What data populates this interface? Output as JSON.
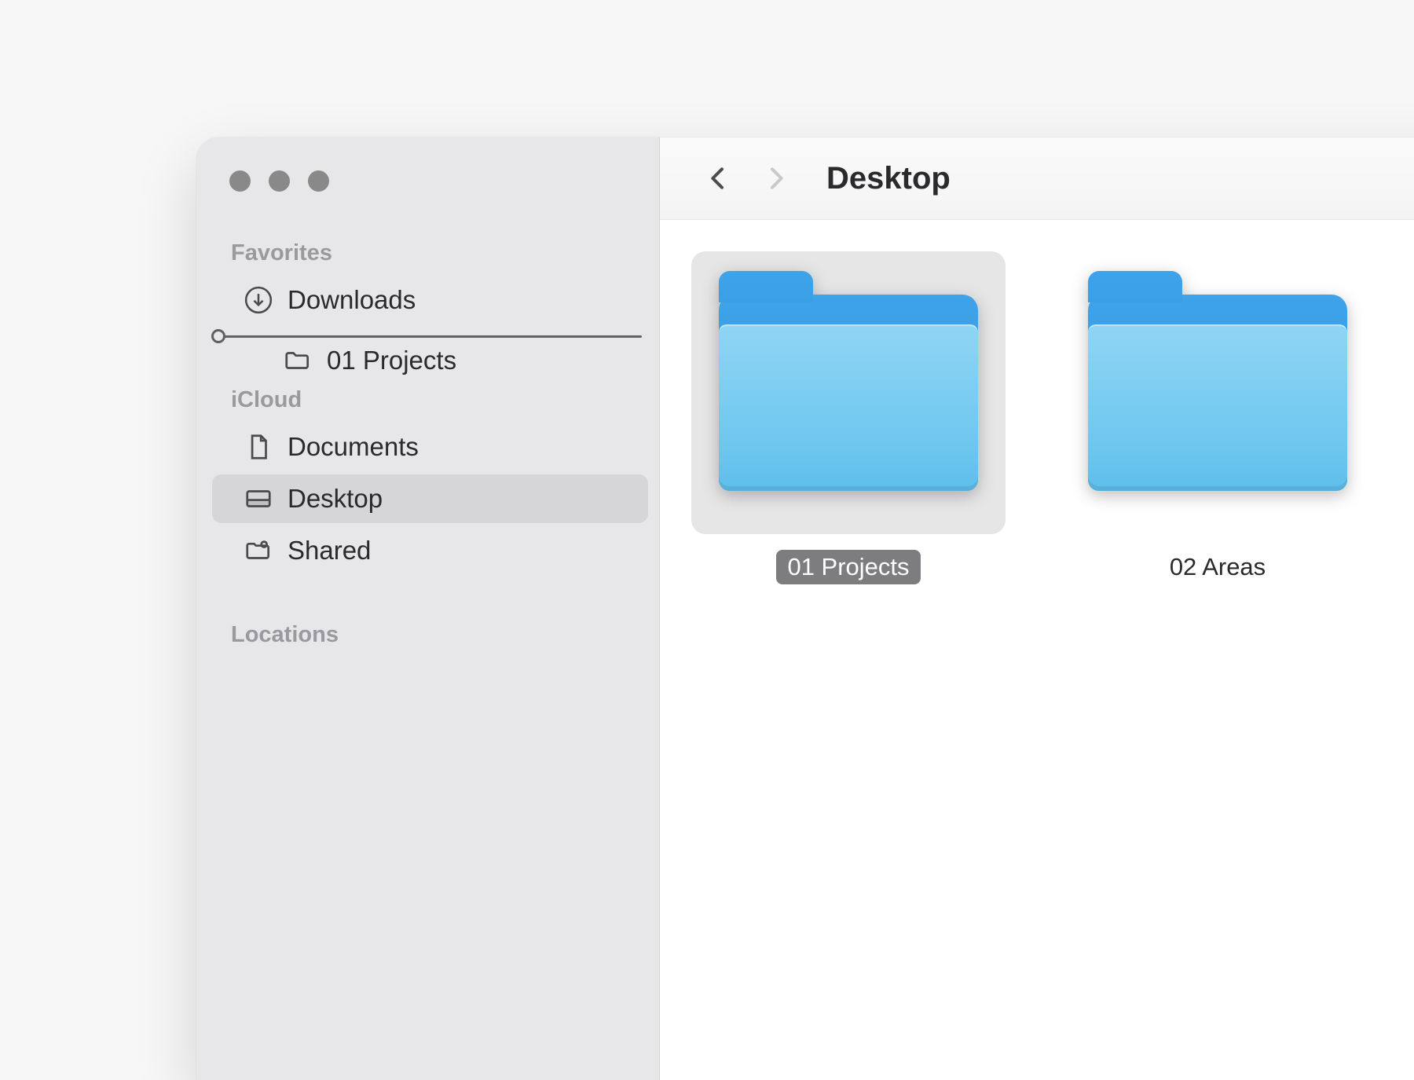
{
  "toolbar": {
    "title": "Desktop"
  },
  "sidebar": {
    "sections": {
      "favorites": {
        "label": "Favorites"
      },
      "icloud": {
        "label": "iCloud"
      },
      "locations": {
        "label": "Locations"
      }
    },
    "favorites": {
      "downloads": {
        "label": "Downloads"
      }
    },
    "drag_item": {
      "label": "01 Projects"
    },
    "icloud": {
      "documents": {
        "label": "Documents"
      },
      "desktop": {
        "label": "Desktop"
      },
      "shared": {
        "label": "Shared"
      }
    }
  },
  "items": [
    {
      "label": "01 Projects",
      "selected": true
    },
    {
      "label": "02 Areas",
      "selected": false
    }
  ]
}
